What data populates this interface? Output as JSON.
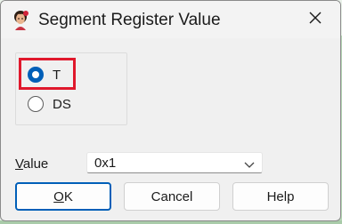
{
  "dialog": {
    "title": "Segment Register Value",
    "app_icon": "app-portrait-icon",
    "close_icon": "close-icon"
  },
  "radio_group": {
    "options": [
      {
        "label": "T",
        "checked": true
      },
      {
        "label": "DS",
        "checked": false
      }
    ],
    "highlight_color": "#e0182c"
  },
  "value_field": {
    "label_prefix": "",
    "label_mnemonic": "V",
    "label_rest": "alue",
    "selected": "0x1"
  },
  "buttons": {
    "ok": {
      "mnemonic": "O",
      "rest": "K"
    },
    "cancel": "Cancel",
    "help": "Help"
  },
  "colors": {
    "accent": "#005fb8",
    "dialog_bg": "#f0f0f0"
  }
}
